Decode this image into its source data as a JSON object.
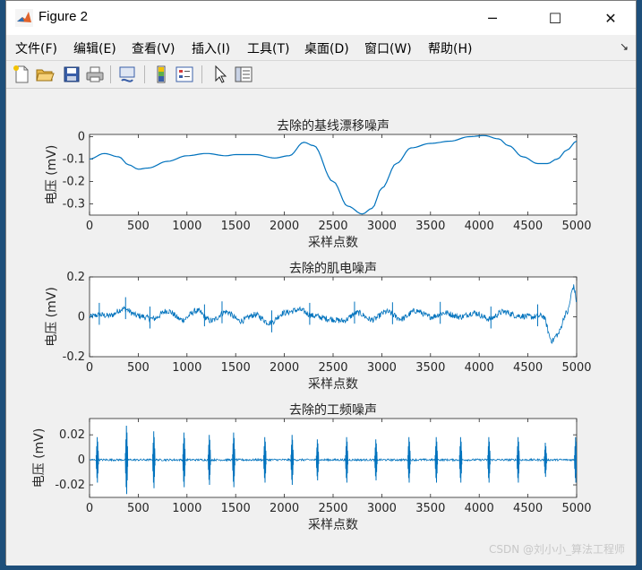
{
  "window": {
    "title": "Figure 2",
    "controls": {
      "minimize": "─",
      "maximize": "☐",
      "close": "✕"
    }
  },
  "menu": {
    "items": [
      {
        "label": "文件(F)",
        "name": "menu-file"
      },
      {
        "label": "编辑(E)",
        "name": "menu-edit"
      },
      {
        "label": "查看(V)",
        "name": "menu-view"
      },
      {
        "label": "插入(I)",
        "name": "menu-insert"
      },
      {
        "label": "工具(T)",
        "name": "menu-tools"
      },
      {
        "label": "桌面(D)",
        "name": "menu-desktop"
      },
      {
        "label": "窗口(W)",
        "name": "menu-window"
      },
      {
        "label": "帮助(H)",
        "name": "menu-help"
      }
    ],
    "expand_icon": "↘"
  },
  "toolbar": {
    "buttons": [
      "new-figure-icon",
      "open-file-icon",
      "save-icon",
      "print-icon",
      "link-plot-icon",
      "insert-colorbar-icon",
      "insert-legend-icon",
      "edit-plot-icon",
      "property-inspector-icon"
    ]
  },
  "chart_data": [
    {
      "type": "line",
      "title": "去除的基线漂移噪声",
      "xlabel": "采样点数",
      "ylabel": "电压 (mV)",
      "xlim": [
        0,
        5000
      ],
      "ylim": [
        -0.35,
        0.01
      ],
      "xticks": [
        0,
        500,
        1000,
        1500,
        2000,
        2500,
        3000,
        3500,
        4000,
        4500,
        5000
      ],
      "yticks": [
        0,
        -0.1,
        -0.2,
        -0.3
      ],
      "ytick_labels": [
        "0",
        "-0.1",
        "-0.2",
        "-0.3"
      ],
      "color": "#0072bd",
      "series": [
        {
          "x": [
            0,
            150,
            300,
            400,
            500,
            600,
            800,
            1000,
            1200,
            1400,
            1500,
            1700,
            1900,
            2050,
            2200,
            2300,
            2500,
            2650,
            2800,
            2900,
            3000,
            3150,
            3300,
            3500,
            3700,
            3900,
            4050,
            4200,
            4300,
            4450,
            4600,
            4700,
            4800,
            4900,
            5000
          ],
          "y": [
            -0.1,
            -0.075,
            -0.09,
            -0.125,
            -0.145,
            -0.14,
            -0.11,
            -0.085,
            -0.075,
            -0.085,
            -0.08,
            -0.08,
            -0.095,
            -0.085,
            -0.025,
            -0.04,
            -0.2,
            -0.31,
            -0.345,
            -0.32,
            -0.23,
            -0.12,
            -0.05,
            -0.03,
            -0.02,
            0.0,
            0.005,
            -0.01,
            -0.04,
            -0.09,
            -0.12,
            -0.12,
            -0.1,
            -0.06,
            -0.02
          ]
        }
      ]
    },
    {
      "type": "line",
      "title": "去除的肌电噪声",
      "xlabel": "采样点数",
      "ylabel": "电压 (mV)",
      "xlim": [
        0,
        5000
      ],
      "ylim": [
        -0.2,
        0.2
      ],
      "xticks": [
        0,
        500,
        1000,
        1500,
        2000,
        2500,
        3000,
        3500,
        4000,
        4500,
        5000
      ],
      "yticks": [
        0.2,
        0,
        -0.2
      ],
      "ytick_labels": [
        "0.2",
        "0",
        "-0.2"
      ],
      "color": "#0072bd",
      "series": [
        {
          "x": [
            0,
            100,
            200,
            350,
            500,
            650,
            800,
            950,
            1100,
            1250,
            1400,
            1550,
            1700,
            1850,
            2000,
            2150,
            2300,
            2450,
            2600,
            2750,
            2900,
            3050,
            3200,
            3350,
            3500,
            3650,
            3800,
            3950,
            4100,
            4250,
            4400,
            4550,
            4650,
            4750,
            4800,
            4900,
            4970,
            5000
          ],
          "y": [
            0.0,
            0.01,
            0.005,
            0.04,
            0.005,
            -0.01,
            0.03,
            -0.015,
            0.03,
            -0.02,
            0.025,
            -0.02,
            0.01,
            -0.03,
            0.02,
            0.035,
            0.005,
            -0.01,
            -0.02,
            0.02,
            -0.015,
            0.025,
            -0.01,
            0.03,
            0.0,
            0.02,
            0.0,
            0.02,
            -0.01,
            0.025,
            0.005,
            0.0,
            0.005,
            -0.12,
            -0.09,
            0.02,
            0.15,
            0.08
          ]
        }
      ],
      "spikes_x": [
        100,
        370,
        620,
        1180,
        1360,
        1870,
        2260,
        2720,
        3110,
        3600,
        4120,
        4600
      ]
    },
    {
      "type": "line",
      "title": "去除的工频噪声",
      "xlabel": "采样点数",
      "ylabel": "电压 (mV)",
      "xlim": [
        0,
        5000
      ],
      "ylim": [
        -0.03,
        0.033
      ],
      "xticks": [
        0,
        500,
        1000,
        1500,
        2000,
        2500,
        3000,
        3500,
        4000,
        4500,
        5000
      ],
      "yticks": [
        0.02,
        0,
        -0.02
      ],
      "ytick_labels": [
        "0.02",
        "0",
        "-0.02"
      ],
      "color": "#0072bd",
      "series": [
        {
          "x": [
            0,
            5000
          ],
          "y": [
            0,
            0
          ]
        }
      ],
      "spikes_x": [
        80,
        380,
        660,
        970,
        1230,
        1480,
        1800,
        2080,
        2340,
        2640,
        2940,
        3280,
        3560,
        3810,
        4100,
        4400,
        4680,
        4990
      ],
      "spikes_amp": [
        0.02,
        0.03,
        0.025,
        0.024,
        0.022,
        0.024,
        0.02,
        0.022,
        0.018,
        0.02,
        0.018,
        0.02,
        0.02,
        0.02,
        0.02,
        0.02,
        0.015,
        0.02
      ]
    }
  ],
  "watermark": "CSDN @刘小小_算法工程师"
}
